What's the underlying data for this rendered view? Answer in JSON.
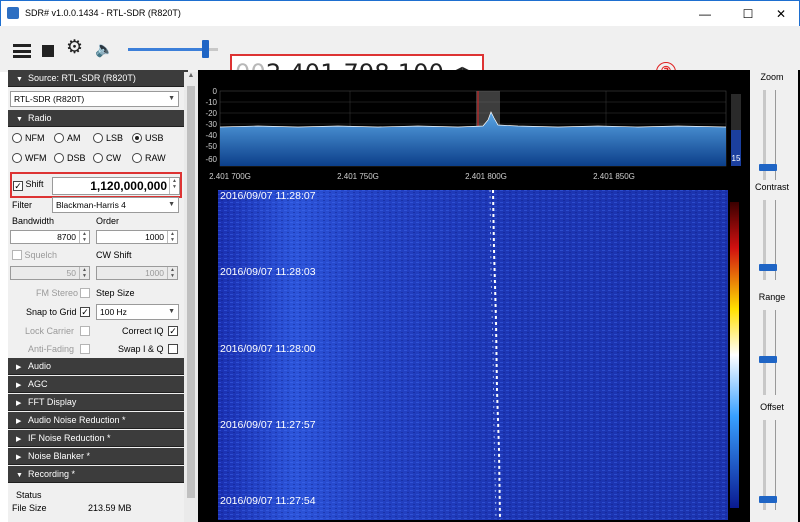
{
  "window": {
    "title": "SDR# v1.0.0.1434 - RTL-SDR (R820T)",
    "min_icon": "minimize-icon",
    "max_icon": "maximize-icon",
    "close_icon": "close-icon"
  },
  "toolbar": {
    "frequency_prefix": "00",
    "frequency_main": "2.401.798.100",
    "annotation_number": "③"
  },
  "source": {
    "header": "Source: RTL-SDR (R820T)",
    "device": "RTL-SDR (R820T)"
  },
  "radio": {
    "header": "Radio",
    "modes": [
      {
        "label": "NFM",
        "selected": false
      },
      {
        "label": "AM",
        "selected": false
      },
      {
        "label": "LSB",
        "selected": false
      },
      {
        "label": "USB",
        "selected": true
      },
      {
        "label": "WFM",
        "selected": false
      },
      {
        "label": "DSB",
        "selected": false
      },
      {
        "label": "CW",
        "selected": false
      },
      {
        "label": "RAW",
        "selected": false
      }
    ],
    "shift_label": "Shift",
    "shift_value": "1,120,000,000",
    "filter_label": "Filter",
    "filter_value": "Blackman-Harris 4",
    "bandwidth_label": "Bandwidth",
    "bandwidth_value": "8700",
    "order_label": "Order",
    "order_value": "1000",
    "squelch_label": "Squelch",
    "squelch_value": "50",
    "cw_shift_label": "CW Shift",
    "cw_shift_value": "1000",
    "fm_stereo_label": "FM Stereo",
    "step_size_label": "Step Size",
    "snap_to_grid_label": "Snap to Grid",
    "step_size_value": "100 Hz",
    "lock_carrier_label": "Lock Carrier",
    "correct_iq_label": "Correct IQ",
    "anti_fading_label": "Anti-Fading",
    "swap_iq_label": "Swap I & Q"
  },
  "panels": [
    "Audio",
    "AGC",
    "FFT Display",
    "Audio Noise Reduction *",
    "IF Noise Reduction *",
    "Noise Blanker *",
    "Recording *"
  ],
  "recording": {
    "status_label": "Status",
    "file_size_label": "File Size",
    "file_size_value": "213.59 MB"
  },
  "spectrum": {
    "y_ticks": [
      "0",
      "-10",
      "-20",
      "-30",
      "-40",
      "-50",
      "-60"
    ],
    "x_ticks": [
      "2.401 700G",
      "2.401 750G",
      "2.401 800G",
      "2.401 850G"
    ],
    "level_value": "15"
  },
  "waterfall": {
    "timestamps": [
      "2016/09/07 11:28:07",
      "2016/09/07 11:28:03",
      "2016/09/07 11:28:00",
      "2016/09/07 11:27:57",
      "2016/09/07 11:27:54"
    ]
  },
  "right_panel": {
    "zoom_label": "Zoom",
    "contrast_label": "Contrast",
    "range_label": "Range",
    "offset_label": "Offset"
  }
}
